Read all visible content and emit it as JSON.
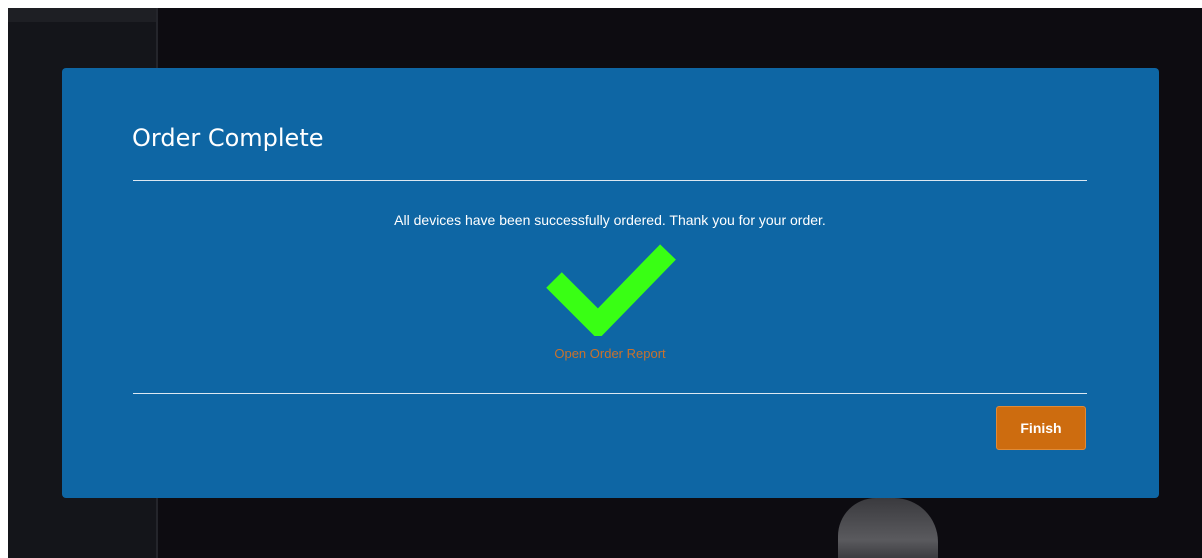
{
  "dialog": {
    "title": "Order Complete",
    "message": "All devices have been successfully ordered. Thank you for your order.",
    "report_link_label": "Open Order Report",
    "finish_label": "Finish",
    "check_icon": "check-mark-icon",
    "colors": {
      "dialog_background": "#0e66a4",
      "check": "#39ff14",
      "link": "#c8722e",
      "finish_button": "#cd6c0f",
      "page_background": "#0d0c11"
    }
  }
}
